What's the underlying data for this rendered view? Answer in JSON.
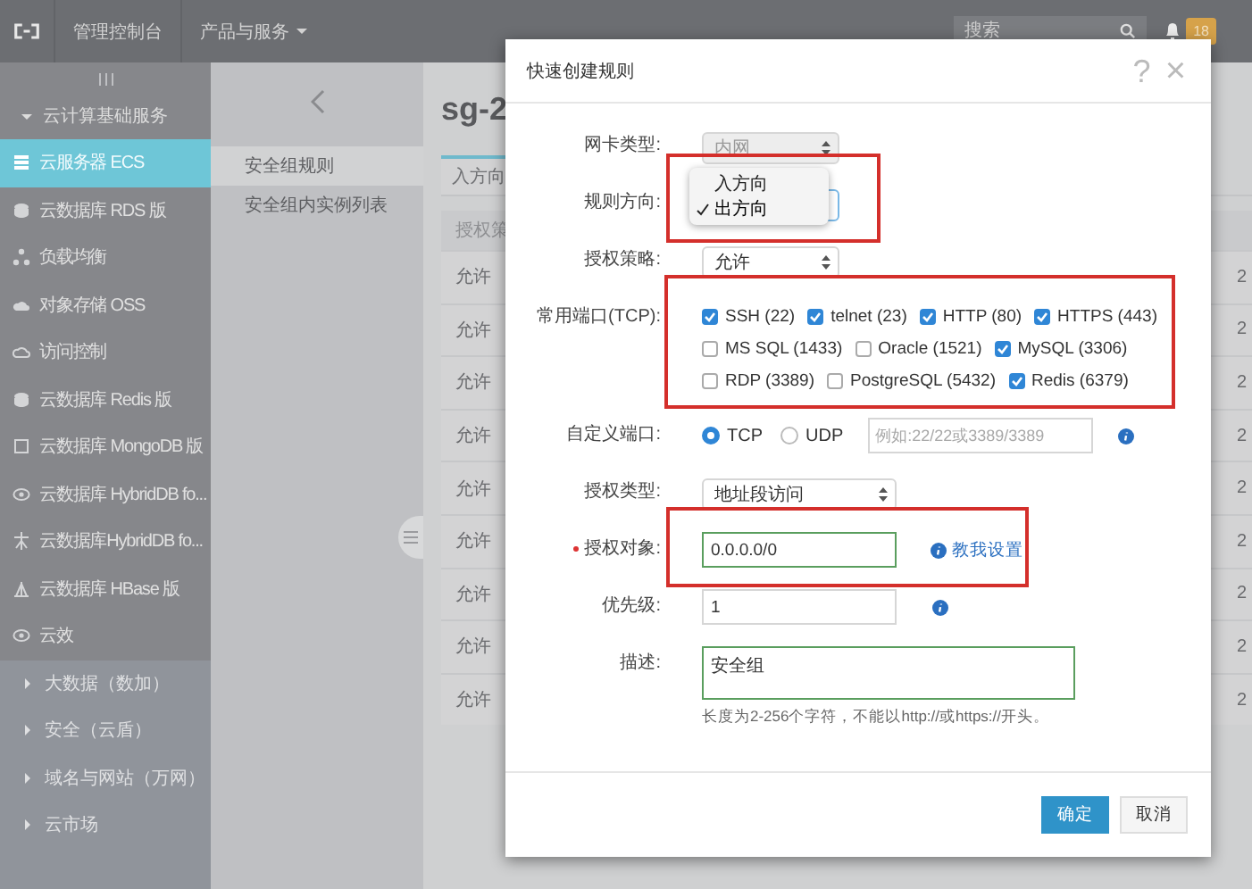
{
  "top_bar": {
    "menu_items": [
      {
        "label": "管理控制台"
      },
      {
        "label": "产品与服务",
        "has_caret": true
      }
    ],
    "search": {
      "placeholder": "搜索"
    },
    "notification_count": "18"
  },
  "sidebar": {
    "section": {
      "label": "云计算基础服务",
      "expanded": true
    },
    "items": [
      {
        "label": "云服务器 ECS",
        "selected": true
      },
      {
        "label": "云数据库 RDS 版",
        "selected": false
      },
      {
        "label": "负载均衡",
        "selected": false
      },
      {
        "label": "对象存储 OSS",
        "selected": false
      },
      {
        "label": "访问控制",
        "selected": false
      },
      {
        "label": "云数据库 Redis 版",
        "selected": false
      },
      {
        "label": "云数据库 MongoDB 版",
        "selected": false
      },
      {
        "label": "云数据库 HybridDB fo...",
        "selected": false
      },
      {
        "label": "云数据库HybridDB fo...",
        "selected": false
      },
      {
        "label": "云数据库 HBase 版",
        "selected": false
      },
      {
        "label": "云效",
        "selected": false
      }
    ],
    "groups": [
      {
        "label": "大数据（数加）",
        "expanded": false
      },
      {
        "label": "安全（云盾）",
        "expanded": false
      },
      {
        "label": "域名与网站（万网）",
        "expanded": false
      },
      {
        "label": "云市场",
        "expanded": false
      }
    ]
  },
  "subnav": {
    "items": [
      {
        "label": "安全组规则",
        "selected": true
      },
      {
        "label": "安全组内实例列表",
        "selected": false
      }
    ]
  },
  "content": {
    "title": "sg-2",
    "tabs": [
      {
        "label": "入方向",
        "selected": true
      }
    ],
    "table": {
      "columns": [
        "授权策"
      ],
      "rows": [
        {
          "column_1": "允许",
          "column_2": "2"
        },
        {
          "column_1": "允许",
          "column_2": "2"
        },
        {
          "column_1": "允许",
          "column_2": "2"
        },
        {
          "column_1": "允许",
          "column_2": "2"
        },
        {
          "column_1": "允许",
          "column_2": "2"
        },
        {
          "column_1": "允许",
          "column_2": "2"
        },
        {
          "column_1": "允许",
          "column_2": "2"
        },
        {
          "column_1": "允许",
          "column_2": "2"
        },
        {
          "column_1": "允许",
          "column_2": "2"
        }
      ]
    }
  },
  "dialog": {
    "title": "快速创建规则",
    "help": "?",
    "close": "×",
    "fields": [
      {
        "kind": "select",
        "label": "网卡类型:",
        "value": "内网",
        "disabled": true
      },
      {
        "kind": "select",
        "label": "规则方向:",
        "highlighted": true,
        "menu": [
          {
            "label": "入方向",
            "selected": false
          },
          {
            "label": "出方向",
            "selected": true
          }
        ]
      },
      {
        "kind": "select",
        "label": "授权策略:",
        "value": "允许"
      },
      {
        "kind": "checkboxes",
        "label": "常用端口(TCP):",
        "highlighted": true,
        "rows": [
          [
            {
              "label": "SSH (22)",
              "checked": true
            },
            {
              "label": "telnet (23)",
              "checked": true
            },
            {
              "label": "HTTP (80)",
              "checked": true
            },
            {
              "label": "HTTPS (443)",
              "checked": true
            }
          ],
          [
            {
              "label": "MS SQL (1433)",
              "checked": false
            },
            {
              "label": "Oracle (1521)",
              "checked": false
            },
            {
              "label": "MySQL (3306)",
              "checked": true
            }
          ],
          [
            {
              "label": "RDP (3389)",
              "checked": false
            },
            {
              "label": "PostgreSQL (5432)",
              "checked": false
            },
            {
              "label": "Redis (6379)",
              "checked": true
            }
          ]
        ]
      },
      {
        "kind": "port",
        "label": "自定义端口:",
        "radios": [
          {
            "label": "TCP",
            "selected": true
          },
          {
            "label": "UDP",
            "selected": false
          }
        ],
        "placeholder": "例如:22/22或3389/3389",
        "info": true
      },
      {
        "kind": "select",
        "label": "授权类型:",
        "value": "地址段访问",
        "wide": true
      },
      {
        "kind": "input",
        "label": "授权对象:",
        "required": true,
        "value": "0.0.0.0/0",
        "valid": true,
        "link": "教我设置",
        "highlighted": true
      },
      {
        "kind": "input",
        "label": "优先级:",
        "value": "1",
        "valid": false,
        "info": true
      },
      {
        "kind": "textarea",
        "label": "描述:",
        "value": "安全组",
        "valid": true,
        "hint": "长度为2-256个字符，不能以http://或https://开头。"
      }
    ]
  },
  "buttons": [
    {
      "label": "确定",
      "primary": true
    },
    {
      "label": "取消",
      "primary": false
    }
  ]
}
